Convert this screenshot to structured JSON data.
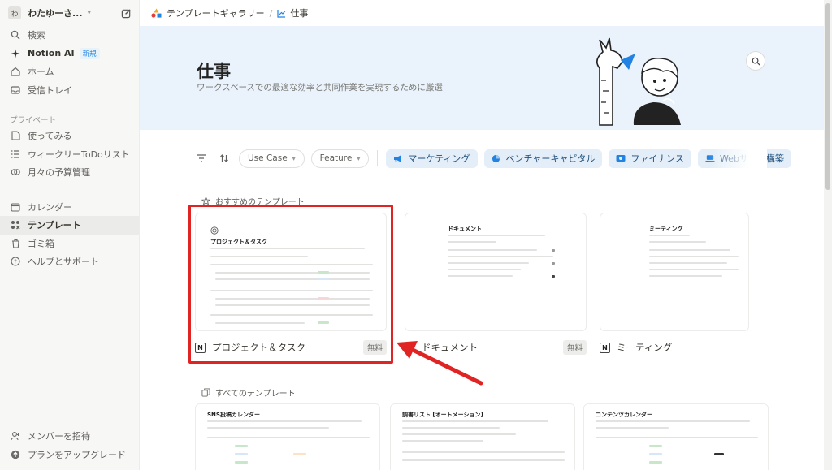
{
  "sidebar": {
    "workspace": {
      "initial": "わ",
      "name": "わたゆーさ..."
    },
    "top_items": [
      {
        "label": "検索",
        "icon": "search-icon"
      },
      {
        "label": "Notion AI",
        "icon": "sparkle-icon",
        "badge": "新規"
      },
      {
        "label": "ホーム",
        "icon": "home-icon"
      },
      {
        "label": "受信トレイ",
        "icon": "inbox-icon"
      }
    ],
    "private_label": "プライベート",
    "private_items": [
      {
        "label": "使ってみる",
        "icon": "page-icon"
      },
      {
        "label": "ウィークリーToDoリスト",
        "icon": "list-icon"
      },
      {
        "label": "月々の予算管理",
        "icon": "budget-icon"
      }
    ],
    "utility_items": [
      {
        "label": "カレンダー",
        "icon": "calendar-icon"
      },
      {
        "label": "テンプレート",
        "icon": "template-icon"
      },
      {
        "label": "ゴミ箱",
        "icon": "trash-icon"
      },
      {
        "label": "ヘルプとサポート",
        "icon": "help-icon"
      }
    ],
    "bottom_items": [
      {
        "label": "メンバーを招待",
        "icon": "invite-icon"
      },
      {
        "label": "プランをアップグレード",
        "icon": "upgrade-icon"
      }
    ]
  },
  "breadcrumb": {
    "gallery": "テンプレートギャラリー",
    "separator": "/",
    "current": "仕事"
  },
  "hero": {
    "title": "仕事",
    "subtitle": "ワークスペースでの最適な効率と共同作業を実現するために厳選"
  },
  "filters": {
    "dropdowns": [
      "Use Case",
      "Feature"
    ],
    "chips": [
      "マーケティング",
      "ベンチャーキャピタル",
      "ファイナンス",
      "Webサイト構築"
    ]
  },
  "featured": {
    "heading": "おすすめのテンプレート",
    "cards": [
      {
        "name": "プロジェクト＆タスク",
        "price": "無料",
        "thumb_title": "プロジェクト＆タスク"
      },
      {
        "name": "ドキュメント",
        "price": "無料",
        "thumb_title": "ドキュメント"
      },
      {
        "name": "ミーティング",
        "price": "",
        "thumb_title": "ミーティング"
      }
    ]
  },
  "all": {
    "heading": "すべてのテンプレート",
    "cards": [
      {
        "thumb_title": "SNS投稿カレンダー"
      },
      {
        "thumb_title": "調書リスト [オートメーション]"
      },
      {
        "thumb_title": "コンテンツカレンダー"
      }
    ]
  },
  "colors": {
    "accent": "#2383e2",
    "hero_bg": "#eaf3fb",
    "chip_bg": "#e3eef8",
    "highlight": "#e02424"
  }
}
